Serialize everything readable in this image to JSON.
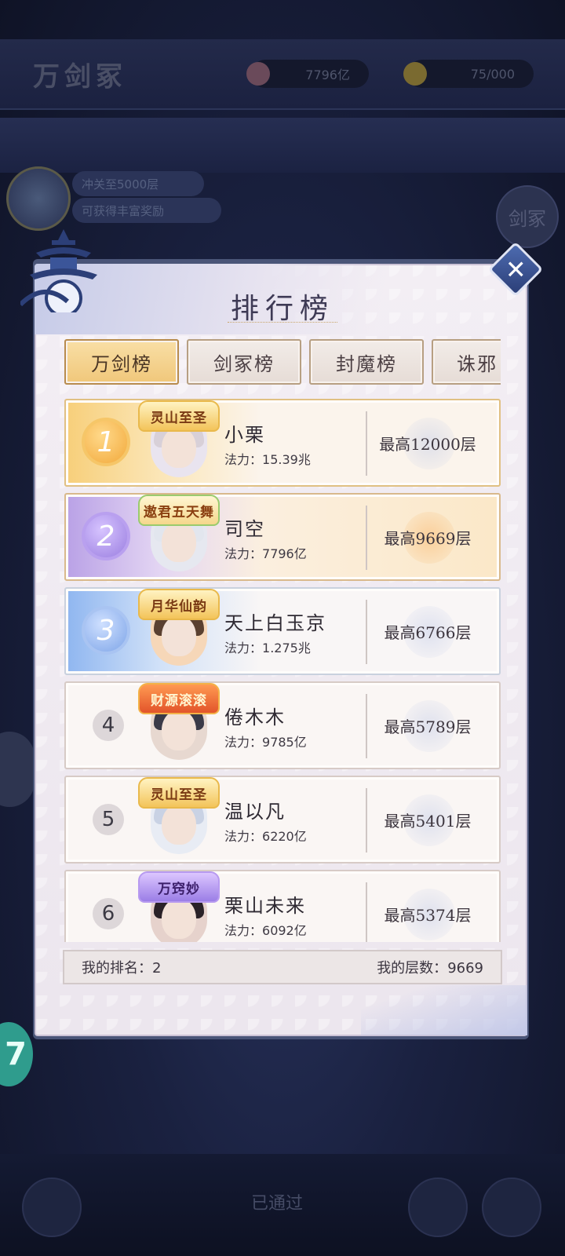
{
  "background": {
    "title": "万剑冢",
    "resource_1": "7796亿",
    "resource_2": "75/000",
    "pill_1": "冲关至5000层",
    "pill_2": "可获得丰富奖励",
    "right_circle": "剑冢",
    "teal_badge": "7",
    "bottom_label": "已通过"
  },
  "panel": {
    "title": "排行榜",
    "close_icon": "close-x-icon"
  },
  "tabs": [
    {
      "label": "万剑榜",
      "active": true
    },
    {
      "label": "剑冢榜",
      "active": false
    },
    {
      "label": "封魔榜",
      "active": false
    },
    {
      "label": "诛邪",
      "active": false
    }
  ],
  "power_label": "法力：",
  "rows": [
    {
      "rank": "1",
      "badge": "灵山至圣",
      "name": "小栗",
      "power": "15.39兆",
      "best": "最高12000层"
    },
    {
      "rank": "2",
      "badge": "遨君五天舞",
      "name": "司空",
      "power": "7796亿",
      "best": "最高9669层"
    },
    {
      "rank": "3",
      "badge": "月华仙韵",
      "name": "天上白玉京",
      "power": "1.275兆",
      "best": "最高6766层"
    },
    {
      "rank": "4",
      "badge": "财源滚滚",
      "name": "倦木木",
      "power": "9785亿",
      "best": "最高5789层"
    },
    {
      "rank": "5",
      "badge": "灵山至圣",
      "name": "温以凡",
      "power": "6220亿",
      "best": "最高5401层"
    },
    {
      "rank": "6",
      "badge": "万窍妙",
      "name": "栗山未来",
      "power": "6092亿",
      "best": "最高5374层"
    }
  ],
  "footer": {
    "my_rank_label": "我的排名：",
    "my_rank": "2",
    "my_floor_label": "我的层数：",
    "my_floor": "9669"
  },
  "colors": {
    "accent_gold": "#f0c77a",
    "panel_bg": "#f3eef4",
    "rank1": "#f2a93b",
    "rank2": "#9a7ee0",
    "rank3": "#7ea5e8"
  }
}
